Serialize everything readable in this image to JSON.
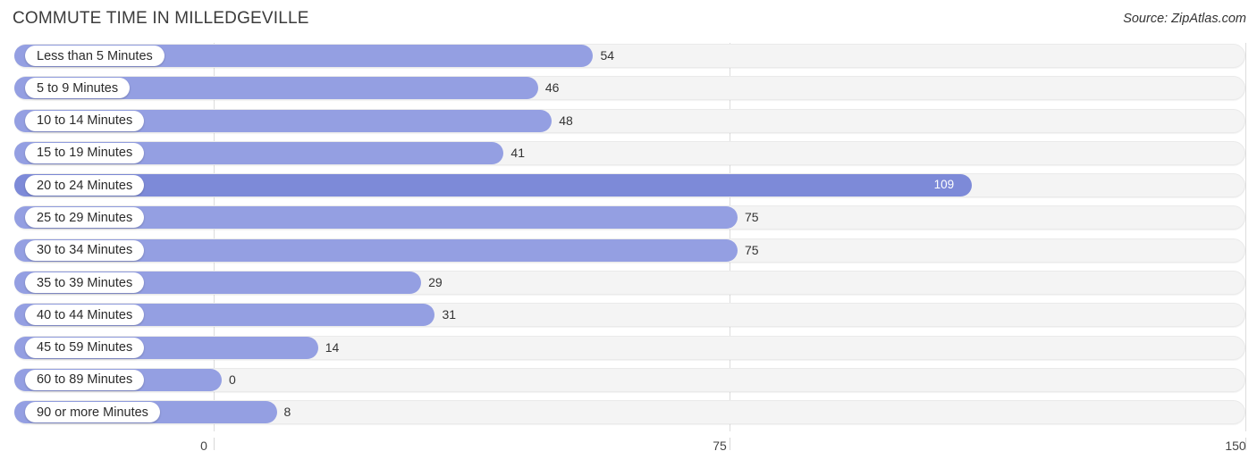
{
  "header": {
    "title": "COMMUTE TIME IN MILLEDGEVILLE",
    "source": "Source: ZipAtlas.com"
  },
  "chart_data": {
    "type": "bar",
    "orientation": "horizontal",
    "title": "COMMUTE TIME IN MILLEDGEVILLE",
    "xlabel": "",
    "ylabel": "",
    "xlim": [
      0,
      150
    ],
    "ticks": [
      0,
      75,
      150
    ],
    "tick_labels": [
      "0",
      "75",
      "150"
    ],
    "grid": true,
    "legend": "none",
    "highlight_category": "20 to 24 Minutes",
    "colors": {
      "bar": "#949fe2",
      "bar_highlight": "#7d8ad8",
      "track": "#f4f4f4",
      "pill": "#ffffff",
      "text": "#333333"
    },
    "categories": [
      "Less than 5 Minutes",
      "5 to 9 Minutes",
      "10 to 14 Minutes",
      "15 to 19 Minutes",
      "20 to 24 Minutes",
      "25 to 29 Minutes",
      "30 to 34 Minutes",
      "35 to 39 Minutes",
      "40 to 44 Minutes",
      "45 to 59 Minutes",
      "60 to 89 Minutes",
      "90 or more Minutes"
    ],
    "values": [
      54,
      46,
      48,
      41,
      109,
      75,
      75,
      29,
      31,
      14,
      0,
      8
    ],
    "value_labels": [
      "54",
      "46",
      "48",
      "41",
      "109",
      "75",
      "75",
      "29",
      "31",
      "14",
      "0",
      "8"
    ]
  }
}
